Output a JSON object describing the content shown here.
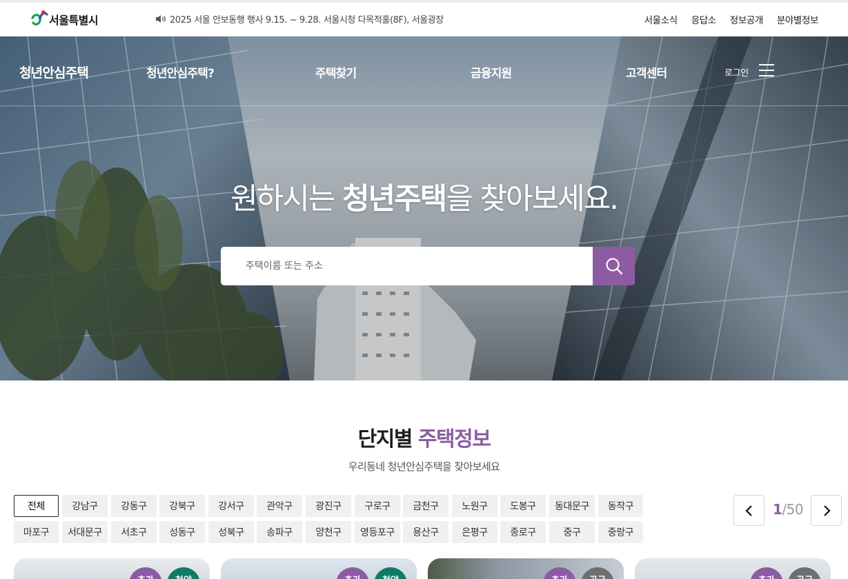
{
  "topbar": {
    "logo_text": "서울특별시",
    "notice": "2025 서울 안보동행 행사 9.15. ~ 9.28. 서울시청 다목적홀(8F), 서울광장",
    "links": [
      "서울소식",
      "응답소",
      "정보공개",
      "분야별정보"
    ]
  },
  "gnb": {
    "brand": "청년안심주택",
    "menu": [
      "청년안심주택?",
      "주택찾기",
      "금융지원",
      "고객센터"
    ],
    "login": "로그인"
  },
  "hero": {
    "title_before": "원하시는 ",
    "title_bold": "청년주택",
    "title_after": "을 찾아보세요.",
    "search_placeholder": "주택이름 또는 주소"
  },
  "section": {
    "title_main": "단지별 ",
    "title_accent": "주택정보",
    "subtitle": "우리동네 청년안심주택을 찾아보세요"
  },
  "districts": [
    "전체",
    "강남구",
    "강동구",
    "강북구",
    "강서구",
    "관악구",
    "광진구",
    "구로구",
    "금천구",
    "노원구",
    "도봉구",
    "동대문구",
    "동작구",
    "마포구",
    "서대문구",
    "서초구",
    "성동구",
    "성북구",
    "송파구",
    "양천구",
    "영등포구",
    "용산구",
    "은평구",
    "종로구",
    "중구",
    "중랑구"
  ],
  "active_district": "전체",
  "pagination": {
    "current": "1",
    "separator": "/",
    "total": "50"
  },
  "cards": [
    {
      "badges": [
        "추가",
        "청약"
      ]
    },
    {
      "badges": [
        "추가",
        "청약"
      ]
    },
    {
      "badges": [
        "추가",
        "공급"
      ]
    },
    {
      "badges": [
        "추가",
        "공급"
      ]
    }
  ],
  "colors": {
    "accent": "#8d5ba3",
    "green": "#0f7a68",
    "gray": "#6f6f6f"
  },
  "icons": {
    "notice": "speaker-icon",
    "search": "search-icon",
    "menu": "hamburger-icon",
    "prev": "chevron-left-icon",
    "next": "chevron-right-icon"
  }
}
